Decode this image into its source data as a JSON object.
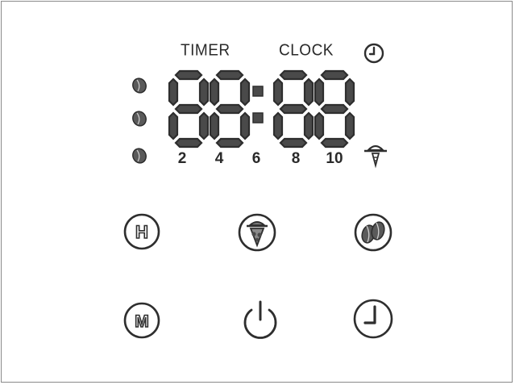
{
  "display": {
    "timer_label": "TIMER",
    "clock_label": "CLOCK",
    "digits": [
      "8",
      "8",
      "8",
      "8"
    ],
    "scale": [
      "2",
      "4",
      "6",
      "8",
      "10"
    ],
    "icons": {
      "clock_indicator": "clock-icon",
      "grind_indicator": "grinder-icon",
      "beans": "coffee-bean-icon"
    }
  },
  "buttons": [
    {
      "name": "hour-button",
      "label": "H",
      "icon": "hour-icon"
    },
    {
      "name": "grind-button",
      "label": "",
      "icon": "grinder-icon"
    },
    {
      "name": "beans-button",
      "label": "",
      "icon": "coffee-beans-icon"
    },
    {
      "name": "minute-button",
      "label": "M",
      "icon": "minute-icon"
    },
    {
      "name": "power-button",
      "label": "",
      "icon": "power-icon"
    },
    {
      "name": "clock-button",
      "label": "",
      "icon": "clock-icon"
    }
  ],
  "colors": {
    "stroke": "#2e2e2e",
    "segment_fill": "#6e6e6e",
    "border": "#8a8a8a"
  }
}
